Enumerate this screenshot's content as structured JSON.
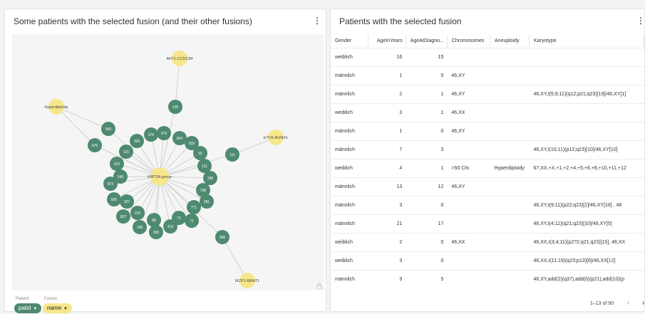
{
  "left": {
    "title": "Some patients with the selected fusion (and their other fusions)",
    "menu": "⋮",
    "graph": {
      "center_label": "KMT2A group",
      "fusions": [
        {
          "id": "f1",
          "label": "AFF1-CCDC84",
          "link": "c135"
        },
        {
          "id": "f2",
          "label": "Hyperdiploidy",
          "link": "c563"
        },
        {
          "id": "f3",
          "label": "ETV6-RUNX1",
          "link": "c111b"
        },
        {
          "id": "f4",
          "label": "IKZF1-BRAT1",
          "link": "c586"
        }
      ],
      "patients": [
        {
          "id": "c135",
          "label": "135"
        },
        {
          "id": "c563",
          "label": "563"
        },
        {
          "id": "c675",
          "label": "675"
        },
        {
          "id": "c111b",
          "label": "111"
        },
        {
          "id": "c586",
          "label": "586"
        },
        {
          "id": "c376",
          "label": "376"
        },
        {
          "id": "c575",
          "label": "575"
        },
        {
          "id": "c844",
          "label": "844"
        },
        {
          "id": "c326",
          "label": "326"
        },
        {
          "id": "c533",
          "label": "533"
        },
        {
          "id": "c131",
          "label": "131"
        },
        {
          "id": "c55",
          "label": "55"
        },
        {
          "id": "c422",
          "label": "422"
        },
        {
          "id": "c111",
          "label": "111"
        },
        {
          "id": "c546",
          "label": "546"
        },
        {
          "id": "c188",
          "label": "188"
        },
        {
          "id": "c873",
          "label": "873"
        },
        {
          "id": "c738",
          "label": "738"
        },
        {
          "id": "c935",
          "label": "935"
        },
        {
          "id": "c327",
          "label": "327"
        },
        {
          "id": "c281",
          "label": "281"
        },
        {
          "id": "c771",
          "label": "771"
        },
        {
          "id": "c857",
          "label": "857"
        },
        {
          "id": "c153",
          "label": "153"
        },
        {
          "id": "c198",
          "label": "198"
        },
        {
          "id": "c71a",
          "label": "71"
        },
        {
          "id": "c71b",
          "label": "71"
        },
        {
          "id": "c88",
          "label": "88"
        },
        {
          "id": "c413",
          "label": "413"
        },
        {
          "id": "c965",
          "label": "965"
        }
      ]
    },
    "legend": {
      "patient_caption": "Patient",
      "fusion_caption": "Fusion",
      "patient_chip": "patid",
      "fusion_chip": "name"
    },
    "colors": {
      "patient": "#4e8a70",
      "fusion": "#f7e78c",
      "edge": "#c8c8c8"
    }
  },
  "right": {
    "title": "Patients with the selected fusion",
    "menu": "⋮",
    "columns": [
      "Gender",
      "AgeInYears",
      "AgeAtDiagno...",
      "Chromosomes",
      "Aneuploidy",
      "Karyotype"
    ],
    "rows": [
      [
        "weiblich",
        "16",
        "15",
        "",
        "",
        ""
      ],
      [
        "männlich",
        "1",
        "0",
        "46,XY",
        "",
        ""
      ],
      [
        "männlich",
        "2",
        "1",
        "46,XY",
        "",
        "46,XY,t(5;9;11)(q12;p21;q23)[19]/46,XY[1]"
      ],
      [
        "weiblich",
        "3",
        "1",
        "46,XX",
        "",
        ""
      ],
      [
        "männlich",
        "1",
        "0",
        "46,XY",
        "",
        ""
      ],
      [
        "männlich",
        "7",
        "3",
        "",
        "",
        "46,XY,t(10;11)(p12;q23)[10]/46,XY[10]"
      ],
      [
        "weiblich",
        "4",
        "1",
        ">50 Chr.",
        "Hyperdiploidy",
        "67,XX,+X,+1,+2,+4,+5,+6,+8,+10,+11,+12"
      ],
      [
        "männlich",
        "13",
        "12",
        "46,XY",
        "",
        ""
      ],
      [
        "männlich",
        "3",
        "0",
        "",
        "",
        "46,XY,t(9;11)(p22;q23)[2]/46,XY[18] , 46"
      ],
      [
        "männlich",
        "21",
        "17",
        "",
        "",
        "46,XY,t(4;11)(q21;q23)[10]/46,XY[5]"
      ],
      [
        "weiblich",
        "2",
        "0",
        "46,XX",
        "",
        "46,XX,t(3;4;11)(p2?2;q21;q23)[15], 46,XX"
      ],
      [
        "weiblich",
        "3",
        "0",
        "",
        "",
        "46,XX,t(11;19)(q23;p13)[6]/46,XX[12]"
      ],
      [
        "männlich",
        "9",
        "5",
        "",
        "",
        "46,XY,add(2)(q37),add(6)(p21),add(10)(p"
      ]
    ],
    "pagination": {
      "range": "1–13 of 90",
      "prev": "‹",
      "next": "›"
    }
  }
}
